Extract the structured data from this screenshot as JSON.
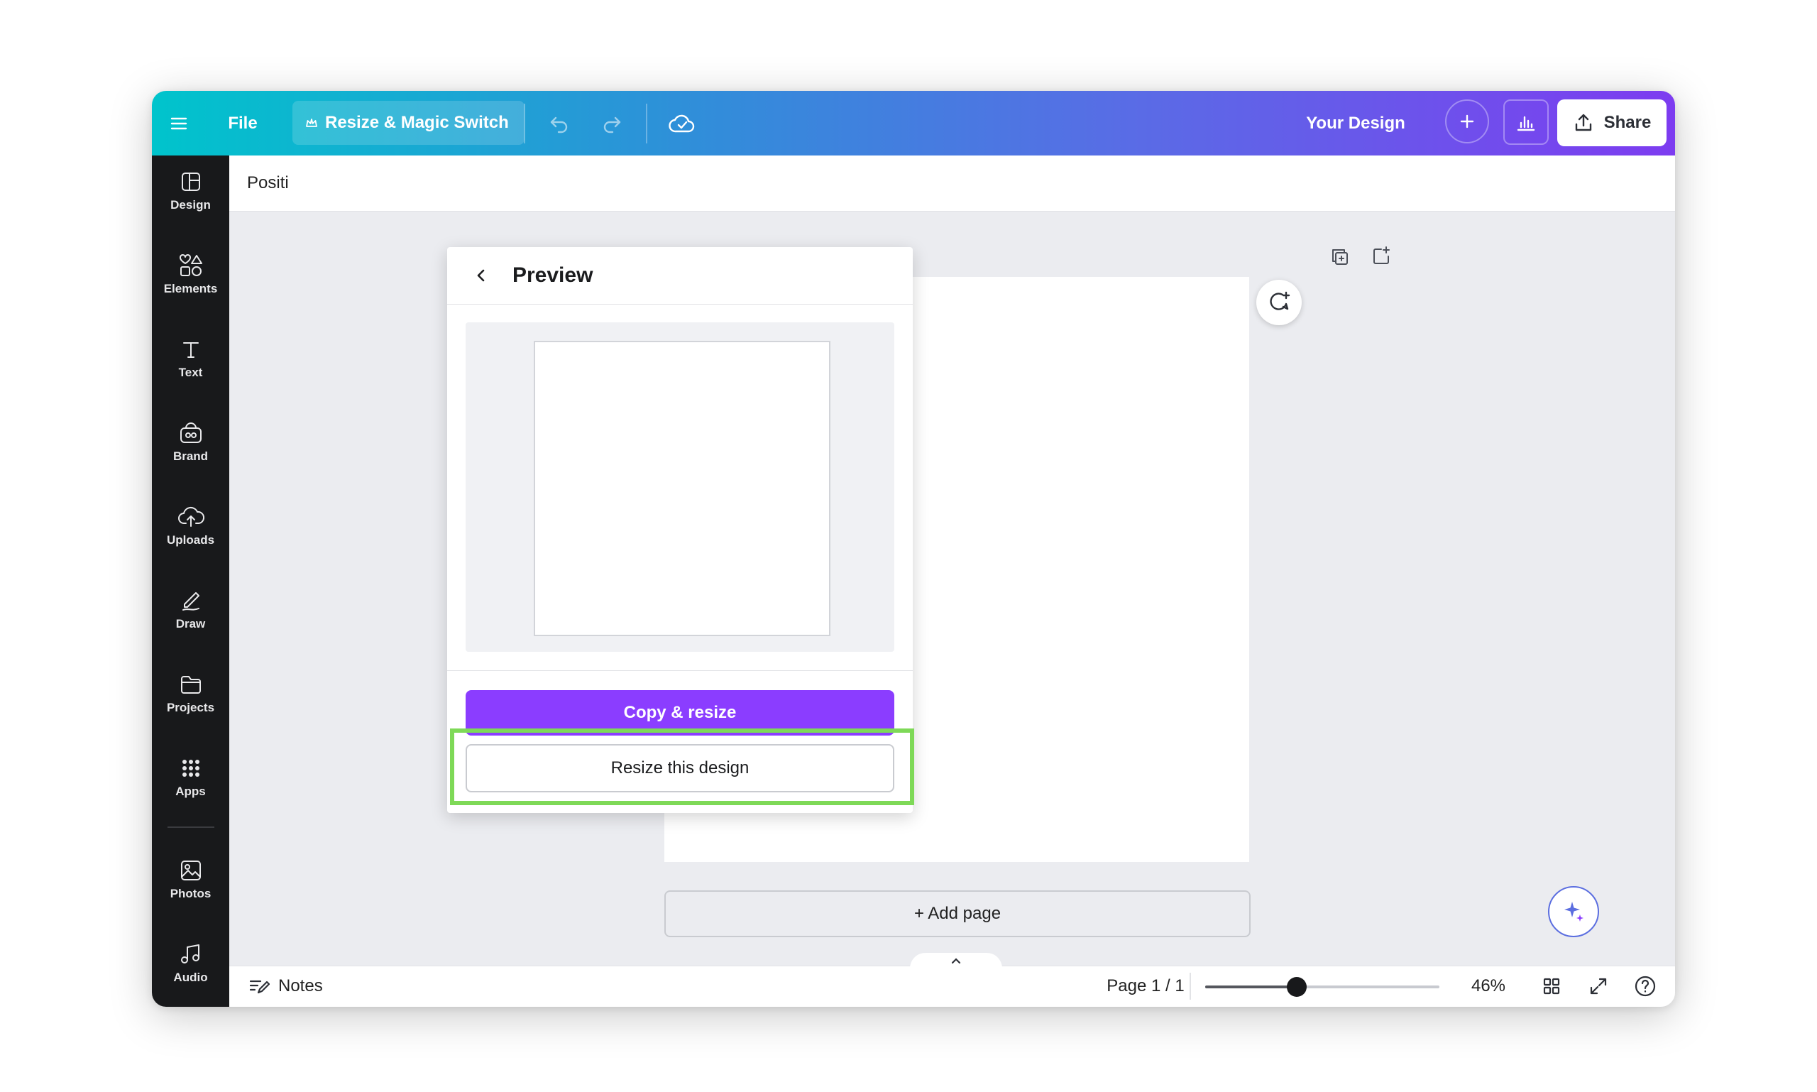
{
  "topbar": {
    "file_label": "File",
    "resize_label": "Resize & Magic Switch",
    "design_title": "Your Design",
    "share_label": "Share",
    "icons": [
      "menu-icon",
      "crown-icon",
      "undo-icon",
      "redo-icon",
      "cloud-sync-icon",
      "plus-icon",
      "analytics-icon",
      "upload-icon"
    ]
  },
  "sidebar": {
    "items": [
      {
        "label": "Design",
        "icon": "design-icon"
      },
      {
        "label": "Elements",
        "icon": "elements-icon"
      },
      {
        "label": "Text",
        "icon": "text-icon"
      },
      {
        "label": "Brand",
        "icon": "brand-icon"
      },
      {
        "label": "Uploads",
        "icon": "uploads-icon"
      },
      {
        "label": "Draw",
        "icon": "draw-icon"
      },
      {
        "label": "Projects",
        "icon": "projects-icon"
      },
      {
        "label": "Apps",
        "icon": "apps-icon"
      },
      {
        "label": "Photos",
        "icon": "photos-icon"
      },
      {
        "label": "Audio",
        "icon": "audio-icon"
      }
    ]
  },
  "context_bar": {
    "label": "Positi"
  },
  "panel": {
    "title": "Preview",
    "copy_resize_label": "Copy & resize",
    "resize_this_label": "Resize this design"
  },
  "canvas": {
    "add_page_label": "+ Add page"
  },
  "bottombar": {
    "notes_label": "Notes",
    "page_label": "Page 1 / 1",
    "zoom_label": "46%",
    "zoom_fraction": 0.39
  },
  "colors": {
    "primary_purple": "#8b3dff",
    "highlight_green": "#7ed957",
    "sidebar_bg": "#18191b",
    "gradient_start": "#00c4cc",
    "gradient_end": "#7d3cf0"
  }
}
